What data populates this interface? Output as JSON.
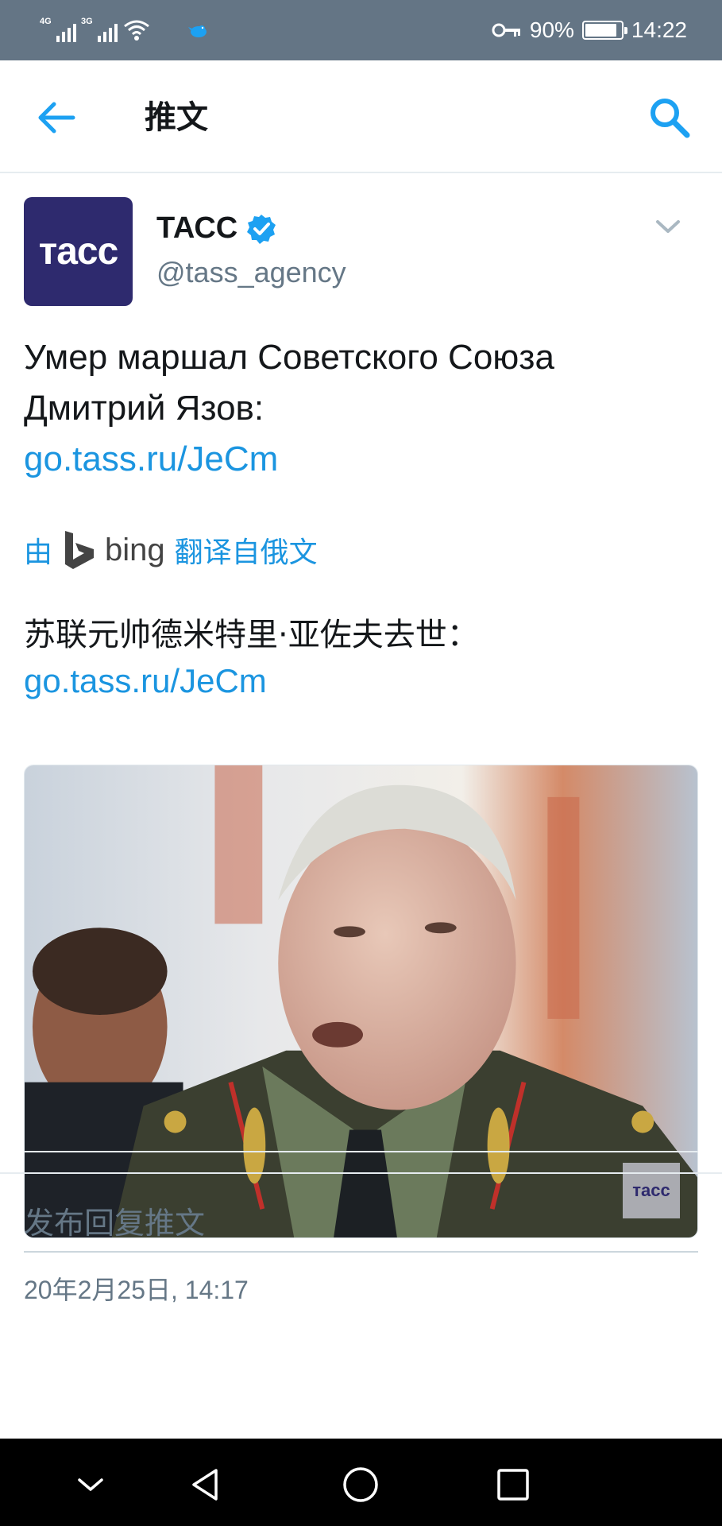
{
  "status_bar": {
    "network_1": "4G",
    "network_2": "3G",
    "battery_percent": "90%",
    "battery_level": 0.9,
    "time": "14:22",
    "icons": [
      "signal-icon",
      "signal-icon",
      "wifi-icon",
      "twitter-bird-icon",
      "key-icon",
      "battery-icon"
    ]
  },
  "header": {
    "title": "推文",
    "back_icon": "back-arrow-icon",
    "search_icon": "search-icon",
    "accent": "#1da1f2"
  },
  "tweet": {
    "avatar_text": "тасс",
    "author_name": "ТАСС",
    "verified": true,
    "handle": "@tass_agency",
    "text_line_1": "Умер маршал Советского Союза",
    "text_line_2": "Дмитрий Язов:",
    "link": "go.tass.ru/JeCm",
    "translation": {
      "prefix": "由",
      "provider": "bing",
      "suffix": "翻译自俄文"
    },
    "translated_text": "苏联元帅德米特里·亚佐夫去世：",
    "translated_link": "go.tass.ru/JeCm",
    "media_watermark": "тасс",
    "timestamp": "20年2月25日, 14:17"
  },
  "reply": {
    "placeholder": "发布回复推文"
  },
  "nav_bar": {
    "icons": [
      "chevron-down-icon",
      "back-triangle-icon",
      "home-circle-icon",
      "recents-square-icon"
    ]
  }
}
